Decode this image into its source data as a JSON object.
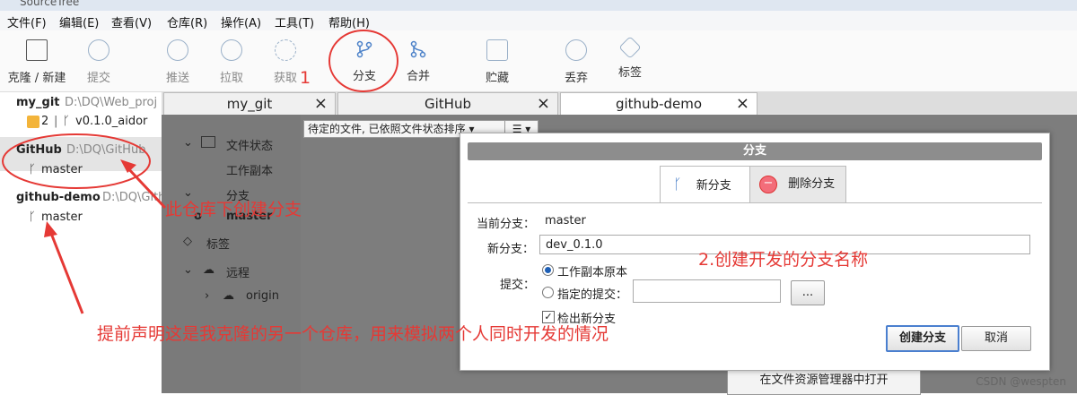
{
  "window": {
    "title": "SourceTree"
  },
  "menu": [
    "文件(F)",
    "编辑(E)",
    "查看(V)",
    "仓库(R)",
    "操作(A)",
    "工具(T)",
    "帮助(H)"
  ],
  "toolbar": {
    "clone": "克隆 / 新建",
    "commit": "提交",
    "push": "推送",
    "pull": "拉取",
    "fetch": "获取",
    "branch": "分支",
    "merge": "合并",
    "stash": "贮藏",
    "discard": "丢弃",
    "tag": "标签"
  },
  "sidebar": {
    "repos": [
      {
        "name": "my_git",
        "path": "D:\\DQ\\Web_proj",
        "badge": "2",
        "branch": "v0.1.0_aidor"
      },
      {
        "name": "GitHub",
        "path": "D:\\DQ\\GitHub",
        "branch": "master"
      },
      {
        "name": "github-demo",
        "path": "D:\\DQ\\Gith",
        "branch": "master"
      }
    ]
  },
  "tabs": [
    {
      "label": "my_git"
    },
    {
      "label": "GitHub"
    },
    {
      "label": "github-demo"
    }
  ],
  "tree": {
    "file_status": "文件状态",
    "working_copy": "工作副本",
    "branches": "分支",
    "master": "master",
    "tags": "标签",
    "remotes": "远程",
    "origin": "origin"
  },
  "filelist": {
    "sort_dropdown": "待定的文件, 已依照文件状态排序",
    "open_explorer": "在文件资源管理器中打开"
  },
  "dialog": {
    "title": "分支",
    "tab_new": "新分支",
    "tab_delete": "删除分支",
    "current_branch_label": "当前分支：",
    "current_branch_value": "master",
    "new_branch_label": "新分支：",
    "new_branch_value": "dev_0.1.0",
    "commit_label": "提交：",
    "option_working_copy": "工作副本原本",
    "option_specified": "指定的提交：",
    "checkout_label": "检出新分支",
    "browse": "...",
    "create_button": "创建分支",
    "cancel_button": "取消"
  },
  "annotations": {
    "step1": "1",
    "step2": "2.创建开发的分支名称",
    "under_repo": "此仓库下创建分支",
    "note": "提前声明这是我克隆的另一个仓库，用来模拟两个人同时开发的情况"
  },
  "watermark": "CSDN @wespten",
  "colors": {
    "annotation_red": "#e53935",
    "dialog_header": "#8d8d8d",
    "primary_border": "#4a7fcf"
  }
}
